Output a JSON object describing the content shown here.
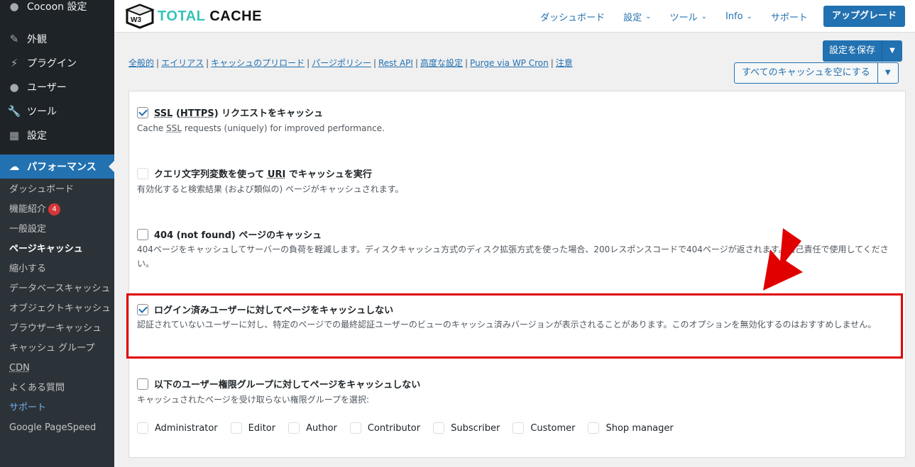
{
  "sidebar": {
    "top_items": [
      {
        "label": "Cocoon 設定",
        "icon": "circle-icon"
      },
      {
        "label": "外観",
        "icon": "paintbrush-icon"
      },
      {
        "label": "プラグイン",
        "icon": "plug-icon"
      },
      {
        "label": "ユーザー",
        "icon": "user-icon"
      },
      {
        "label": "ツール",
        "icon": "wrench-icon"
      },
      {
        "label": "設定",
        "icon": "settings-icon"
      }
    ],
    "active": {
      "label": "パフォーマンス",
      "icon": "performance-icon"
    },
    "submenu": [
      {
        "label": "ダッシュボード"
      },
      {
        "label": "機能紹介",
        "badge": "4"
      },
      {
        "label": "一般設定"
      },
      {
        "label": "ページキャッシュ",
        "current": true
      },
      {
        "label": "縮小する"
      },
      {
        "label": "データベースキャッシュ"
      },
      {
        "label": "オブジェクトキャッシュ"
      },
      {
        "label": "ブラウザーキャッシュ"
      },
      {
        "label": "キャッシュ グループ"
      },
      {
        "label": "CDN"
      },
      {
        "label": "よくある質問"
      },
      {
        "label": "サポート"
      },
      {
        "label": "Google PageSpeed"
      }
    ]
  },
  "header": {
    "logo_word1": "TOTAL",
    "logo_word2": "CACHE",
    "logo_badge": "W3",
    "nav": [
      {
        "label": "ダッシュボード",
        "dropdown": false
      },
      {
        "label": "設定",
        "dropdown": true
      },
      {
        "label": "ツール",
        "dropdown": true
      },
      {
        "label": "Info",
        "dropdown": true
      },
      {
        "label": "サポート",
        "dropdown": false
      }
    ],
    "upgrade_label": "アップグレード"
  },
  "subnav": [
    "全般的",
    "エイリアス",
    "キャッシュのプリロード",
    "パージポリシー",
    "Rest API",
    "高度な設定",
    "Purge via WP Cron",
    "注意"
  ],
  "actions": {
    "save_label": "設定を保存",
    "empty_label": "すべてのキャッシュを空にする"
  },
  "options": [
    {
      "title_parts": [
        "SSL",
        " (",
        "HTTPS",
        ") リクエストをキャッシュ"
      ],
      "desc_parts": [
        "Cache ",
        "SSL",
        " requests (uniquely) for improved performance."
      ],
      "checked": true
    },
    {
      "title_parts": [
        "クエリ文字列変数を使って ",
        "URI",
        " でキャッシュを実行"
      ],
      "desc": "有効化すると検索結果 (および類似の) ページがキャッシュされます。",
      "checked": false
    },
    {
      "title": "404 (not found) ページのキャッシュ",
      "desc": "404ページをキャッシュしてサーバーの負荷を軽減します。ディスクキャッシュ方式のディスク拡張方式を使った場合、200レスポンスコードで404ページが返されます。自己責任で使用してください。",
      "checked": false
    },
    {
      "title": "ログイン済みユーザーに対してページをキャッシュしない",
      "desc": "認証されていないユーザーに対し、特定のページでの最終認証ユーザーのビューのキャッシュ済みバージョンが表示されることがあります。このオプションを無効化するのはおすすめしません。",
      "checked": true
    },
    {
      "title": "以下のユーザー権限グループに対してページをキャッシュしない",
      "desc": "キャッシュされたページを受け取らない権限グループを選択:",
      "checked": false
    }
  ],
  "roles": [
    "Administrator",
    "Editor",
    "Author",
    "Contributor",
    "Subscriber",
    "Customer",
    "Shop manager"
  ],
  "colors": {
    "accent": "#2271b1",
    "highlight": "#e00000",
    "sidebar": "#1d2327",
    "logo_teal": "#34c3b8"
  }
}
